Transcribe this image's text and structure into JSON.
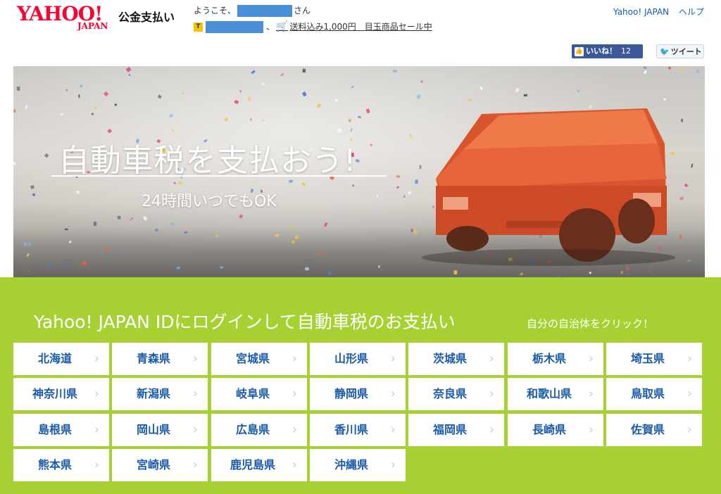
{
  "header": {
    "logo_main": "YAHOO!",
    "logo_sub": "JAPAN",
    "service_name": "公金支払い",
    "welcome_prefix": "ようこそ、",
    "welcome_suffix": "さん",
    "tpoint_suffix": "、",
    "promo_text": "送料込み1,000円　目玉商品セール中",
    "links": [
      "Yahoo! JAPAN",
      "ヘルプ"
    ]
  },
  "social": {
    "like_label": "いいね！",
    "like_count": "12",
    "tweet_label": "ツイート"
  },
  "hero": {
    "title": "自動車税を支払おう!",
    "subtitle": "24時間いつでもOK"
  },
  "section": {
    "title": "Yahoo! JAPAN IDにログインして自動車税のお支払い",
    "note": "自分の自治体をクリック！"
  },
  "prefectures": [
    "北海道",
    "青森県",
    "宮城県",
    "山形県",
    "茨城県",
    "栃木県",
    "埼玉県",
    "神奈川県",
    "新潟県",
    "岐阜県",
    "静岡県",
    "奈良県",
    "和歌山県",
    "鳥取県",
    "島根県",
    "岡山県",
    "広島県",
    "香川県",
    "福岡県",
    "長崎県",
    "佐賀県",
    "熊本県",
    "宮崎県",
    "鹿児島県",
    "沖縄県"
  ],
  "colors": {
    "brand_red": "#ff0033",
    "section_green": "#a7d133",
    "link_blue": "#1a5aa8",
    "car_orange": "#e8552a"
  }
}
